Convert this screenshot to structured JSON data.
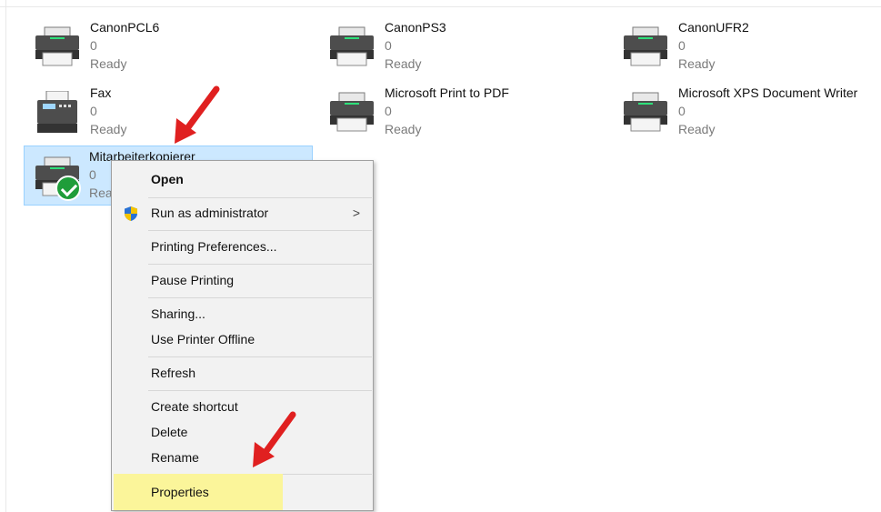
{
  "printers": [
    {
      "name": "CanonPCL6",
      "count": "0",
      "status": "Ready"
    },
    {
      "name": "CanonPS3",
      "count": "0",
      "status": "Ready"
    },
    {
      "name": "CanonUFR2",
      "count": "0",
      "status": "Ready"
    },
    {
      "name": "Fax",
      "count": "0",
      "status": "Ready"
    },
    {
      "name": "Microsoft Print to PDF",
      "count": "0",
      "status": "Ready"
    },
    {
      "name": "Microsoft XPS Document Writer",
      "count": "0",
      "status": "Ready"
    },
    {
      "name": "Mitarbeiterkopierer",
      "count": "0",
      "status": "Ready"
    }
  ],
  "context_menu": {
    "open": "Open",
    "run_as_admin": "Run as administrator",
    "printing_prefs": "Printing Preferences...",
    "pause": "Pause Printing",
    "sharing": "Sharing...",
    "offline": "Use Printer Offline",
    "refresh": "Refresh",
    "shortcut": "Create shortcut",
    "delete": "Delete",
    "rename": "Rename",
    "properties": "Properties",
    "submenu_chevron": ">"
  },
  "colors": {
    "selection": "#cce8ff",
    "highlight": "#fbf59a",
    "arrow": "#e02020",
    "default_check": "#1f9d3a"
  },
  "icons": [
    "printer-icon",
    "default-printer-check-icon",
    "uac-shield-icon",
    "chevron-right-icon",
    "red-arrow-annotation"
  ]
}
